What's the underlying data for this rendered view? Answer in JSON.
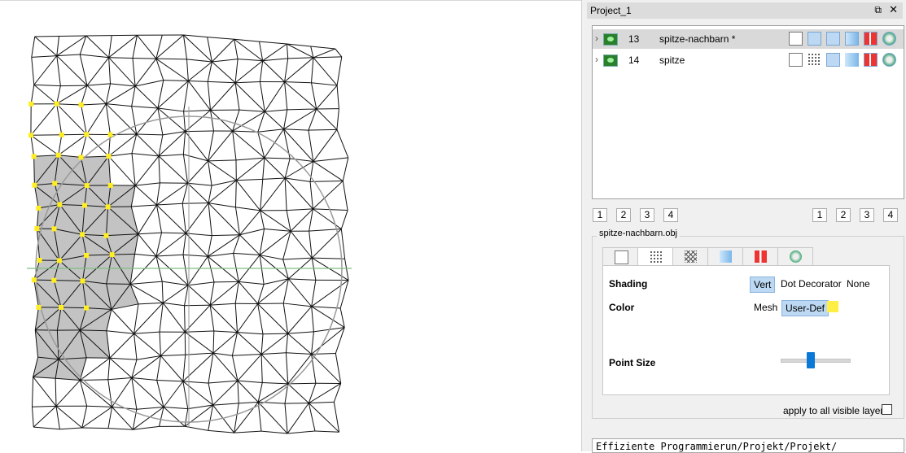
{
  "panel": {
    "title": "Project_1",
    "float_glyph": "⧉",
    "close_glyph": "✕"
  },
  "layers": [
    {
      "id": "13",
      "name": "spitze-nachbarn *",
      "selected": true,
      "visible": true
    },
    {
      "id": "14",
      "name": "spitze",
      "selected": false,
      "visible": true
    }
  ],
  "layer_icons": [
    "box-icon",
    "points-icon",
    "wireframe-icon",
    "smooth-icon",
    "texture-icon",
    "decorator-icon"
  ],
  "row_icon_states": [
    [
      false,
      true,
      true,
      true,
      true,
      true
    ],
    [
      false,
      false,
      true,
      false,
      true,
      true
    ]
  ],
  "numbers_left": [
    "1",
    "2",
    "3",
    "4"
  ],
  "numbers_right": [
    "1",
    "2",
    "3",
    "4"
  ],
  "properties": {
    "group_title": "spitze-nachbarn.obj",
    "tabs": [
      "box-icon",
      "points-icon",
      "wireframe-icon",
      "smooth-icon",
      "texture-icon",
      "decorator-icon"
    ],
    "active_tab": 1,
    "shading_label": "Shading",
    "shading_options": [
      "Vert",
      "Dot Decorator",
      "None"
    ],
    "shading_selected": "Vert",
    "color_label": "Color",
    "color_options": [
      "Mesh",
      "User-Def"
    ],
    "color_selected": "User-Def",
    "user_color": "#ffee44",
    "point_size_label": "Point Size",
    "point_size_fraction": 0.43
  },
  "apply_label": "apply to all visible layers",
  "apply_checked": false,
  "path_text": "Effiziente Programmierun/Projekt/Projekt/",
  "colors": {
    "mesh_line": "#111111",
    "selected_fill": "#b8b8b8",
    "selected_point": "#ffee22",
    "trackball": "#9a9a9a",
    "axis_green": "#7fbf7f",
    "accent": "#0a78d7"
  },
  "expand_glyph": "›"
}
